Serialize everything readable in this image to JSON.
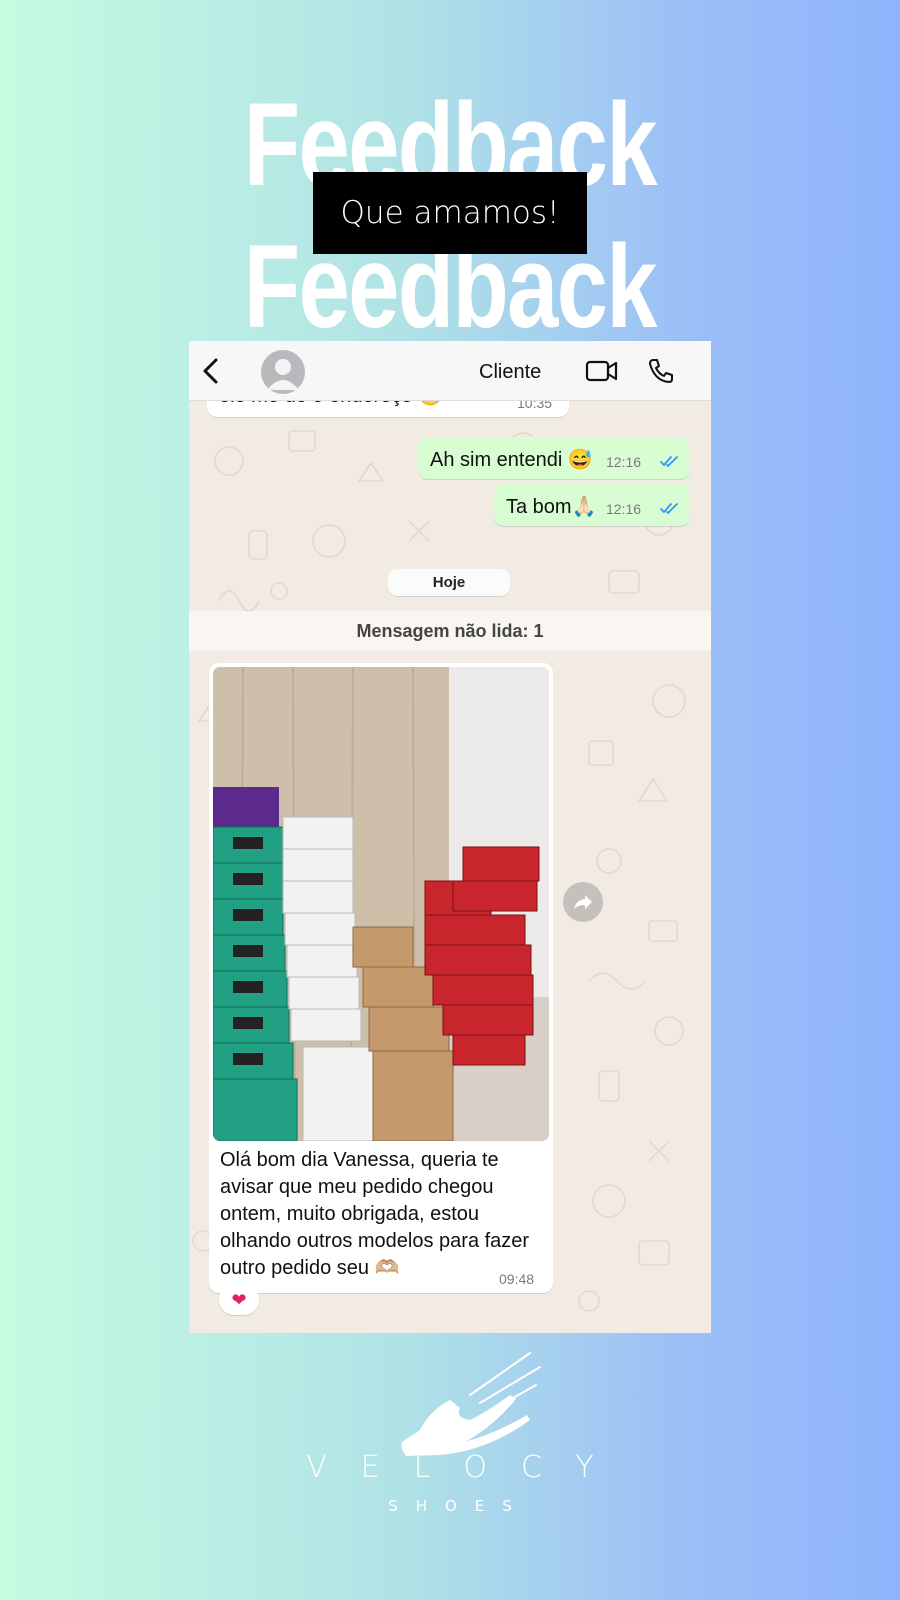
{
  "banner": {
    "headline": "Feedback",
    "headline_repeat": "Feedback",
    "tagline": "Que amamos!"
  },
  "chat": {
    "contact_name": "Cliente",
    "messages": [
      {
        "direction": "in",
        "text": "ele me dê o endereço 😊",
        "time": "10:35"
      },
      {
        "direction": "out",
        "text": "Ah sim entendi 😅",
        "time": "12:16",
        "status": "read"
      },
      {
        "direction": "out",
        "text": "Ta bom🙏🏻",
        "time": "12:16",
        "status": "read"
      }
    ],
    "day_separator": "Hoje",
    "unread_notice": "Mensagem não lida: 1",
    "photo_message": {
      "caption": "Olá bom dia Vanessa, queria te avisar que meu pedido chegou ontem, muito obrigada, estou olhando outros modelos para fazer outro pedido seu 🫶🏼",
      "time": "09:48",
      "reaction": "❤"
    },
    "colors": {
      "outgoing_bubble": "#d9fdd3",
      "incoming_bubble": "#ffffff",
      "read_ticks": "#3497f9",
      "wallpaper": "#f1ebe3"
    },
    "icons": [
      "chevron-left-icon",
      "avatar-icon",
      "video-camera-icon",
      "phone-icon",
      "double-check-icon",
      "forward-icon",
      "heart-icon"
    ]
  },
  "brand": {
    "name": "VELOCY",
    "sub": "SHOES"
  }
}
